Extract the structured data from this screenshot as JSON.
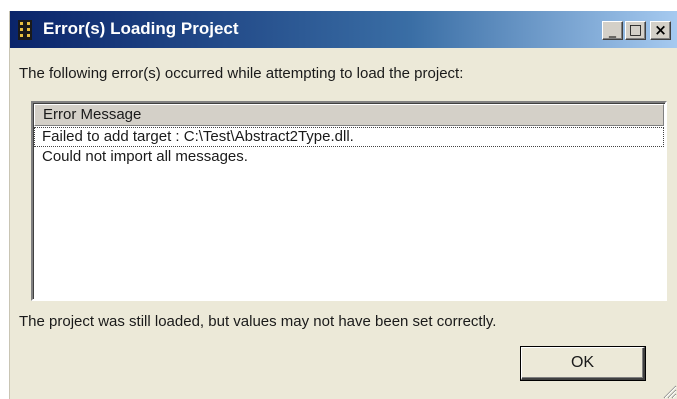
{
  "window": {
    "title": "Error(s) Loading Project",
    "minimize_label": "_",
    "maximize_label": "□",
    "close_label": "×"
  },
  "message": "The following error(s) occurred while attempting to load the project:",
  "list": {
    "column_header": "Error Message",
    "rows": [
      "Failed to add target : C:\\Test\\Abstract2Type.dll.",
      "Could not import all messages."
    ]
  },
  "footer": "The project was still loaded, but values may not have been set correctly.",
  "ok_label": "OK",
  "colors": {
    "title_start": "#0a246a",
    "title_end": "#a6caf0",
    "dialog_bg": "#ece9d8"
  }
}
